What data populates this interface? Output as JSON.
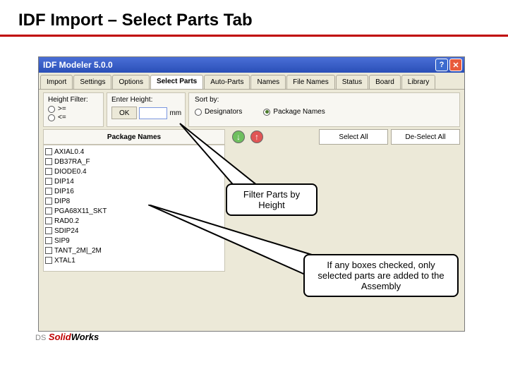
{
  "slide": {
    "title": "IDF Import – Select Parts Tab"
  },
  "window": {
    "title": "IDF Modeler 5.0.0",
    "tabs": [
      "Import",
      "Settings",
      "Options",
      "Select Parts",
      "Auto-Parts",
      "Names",
      "File Names",
      "Status",
      "Board",
      "Library"
    ],
    "active_tab": 3
  },
  "height_filter": {
    "group_label": "Height Filter:",
    "opt_ge": ">=",
    "opt_le": "<=",
    "enter_label": "Enter Height:",
    "value": "",
    "unit": "mm",
    "ok": "OK"
  },
  "sort_by": {
    "group_label": "Sort by:",
    "opt_designators": "Designators",
    "opt_package_names": "Package Names",
    "selected": "package_names"
  },
  "headers": {
    "package_names": "Package Names",
    "select_all": "Select All",
    "deselect_all": "De-Select All"
  },
  "parts": [
    "AXIAL0.4",
    "DB37RA_F",
    "DIODE0.4",
    "DIP14",
    "DIP16",
    "DIP8",
    "PGA68X11_SKT",
    "RAD0.2",
    "SDIP24",
    "SIP9",
    "TANT_2M|_2M",
    "XTAL1"
  ],
  "callouts": {
    "c1": "Filter Parts by Height",
    "c2": "If any boxes checked, only selected parts are added to the Assembly"
  },
  "help_glyph": "?",
  "close_glyph": "✕",
  "logo": {
    "brand": "Solid",
    "works": "Works",
    "ds": "DS"
  }
}
